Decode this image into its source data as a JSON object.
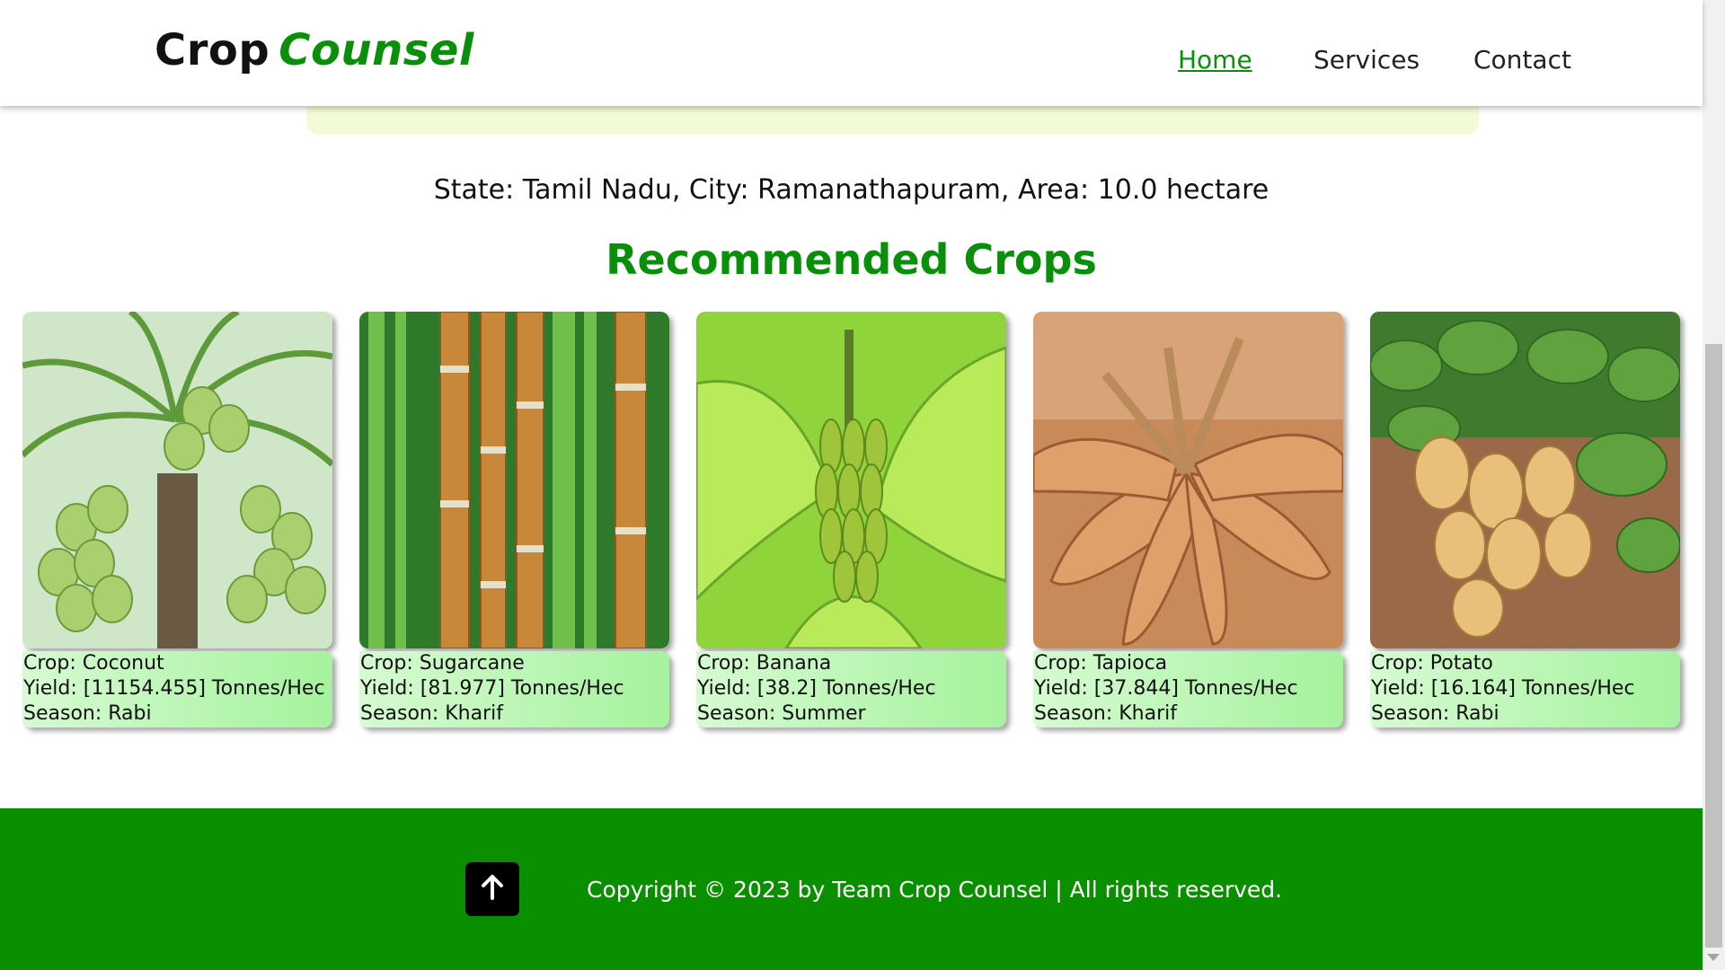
{
  "header": {
    "logo_word1": "Crop",
    "logo_word2": "Counsel",
    "nav": {
      "home": "Home ",
      "services": "Services",
      "contact": "Contact"
    }
  },
  "location_text": "State: Tamil Nadu, City: Ramanathapuram, Area: 10.0 hectare",
  "section_title": "Recommended Crops",
  "cards": [
    {
      "crop": "Crop: Coconut",
      "yield": "Yield: [11154.455] Tonnes/Hec",
      "season": "Season: Rabi",
      "icon": "coconut-photo"
    },
    {
      "crop": "Crop: Sugarcane",
      "yield": "Yield: [81.977] Tonnes/Hec",
      "season": "Season: Kharif",
      "icon": "sugarcane-photo"
    },
    {
      "crop": "Crop: Banana",
      "yield": "Yield: [38.2] Tonnes/Hec",
      "season": "Season: Summer",
      "icon": "banana-photo"
    },
    {
      "crop": "Crop: Tapioca",
      "yield": "Yield: [37.844] Tonnes/Hec",
      "season": "Season: Kharif",
      "icon": "tapioca-photo"
    },
    {
      "crop": "Crop: Potato",
      "yield": "Yield: [16.164] Tonnes/Hec",
      "season": "Season: Rabi",
      "icon": "potato-photo"
    }
  ],
  "footer": {
    "copyright": "Copyright © 2023 by Team Crop Counsel | All rights reserved.",
    "scroll_top_icon": "arrow-up-icon"
  },
  "colors": {
    "brand_green": "#0a8f0a",
    "footer_green": "#0a8f00",
    "card_info_gradient_start": "#d6fbd2",
    "card_info_gradient_end": "#a5f29d"
  }
}
